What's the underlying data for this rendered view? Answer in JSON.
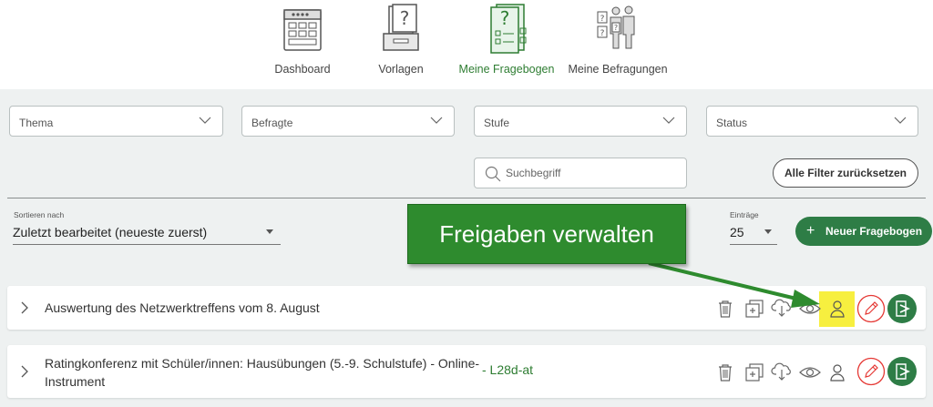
{
  "nav": {
    "dashboard": "Dashboard",
    "vorlagen": "Vorlagen",
    "fragebogen": "Meine Fragebogen",
    "befragungen": "Meine Befragungen"
  },
  "filters": {
    "thema": "Thema",
    "befragte": "Befragte",
    "stufe": "Stufe",
    "status": "Status",
    "search_placeholder": "Suchbegriff",
    "reset": "Alle Filter zurücksetzen"
  },
  "sort": {
    "caption": "Sortieren nach",
    "value": "Zuletzt bearbeitet (neueste zuerst)"
  },
  "entries": {
    "caption": "Einträge",
    "value": "25"
  },
  "new_button": "Neuer Fragebogen",
  "callout": "Freigaben verwalten",
  "rows": [
    {
      "title": "Auswertung des Netzwerktreffens vom 8. August",
      "code": ""
    },
    {
      "title_line1": "Ratingkonferenz mit Schüler/innen: Hausübungen (5.-9. Schulstufe) - Online-",
      "title_line2": "Instrument",
      "code": "- L28d-at"
    }
  ],
  "colors": {
    "accent": "#2e7d46",
    "callout": "#2e8b2e",
    "highlight": "#f7ef3f",
    "edit": "#e53935"
  }
}
